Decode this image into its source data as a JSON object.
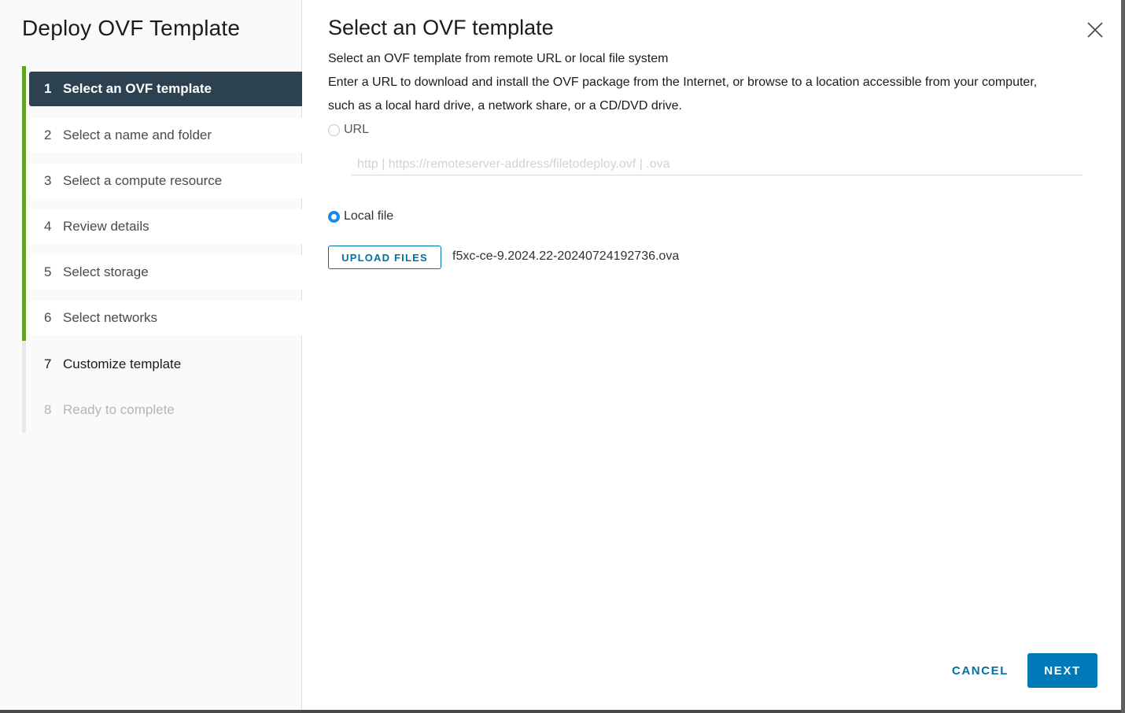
{
  "wizard": {
    "title": "Deploy OVF Template",
    "steps": [
      {
        "number": "1",
        "label": "Select an OVF template",
        "state": "active"
      },
      {
        "number": "2",
        "label": "Select a name and folder",
        "state": "done"
      },
      {
        "number": "3",
        "label": "Select a compute resource",
        "state": "done"
      },
      {
        "number": "4",
        "label": "Review details",
        "state": "done"
      },
      {
        "number": "5",
        "label": "Select storage",
        "state": "done"
      },
      {
        "number": "6",
        "label": "Select networks",
        "state": "done"
      },
      {
        "number": "7",
        "label": "Customize template",
        "state": "next"
      },
      {
        "number": "8",
        "label": "Ready to complete",
        "state": "disabled"
      }
    ]
  },
  "page": {
    "title": "Select an OVF template",
    "subtitle": "Select an OVF template from remote URL or local file system",
    "description": "Enter a URL to download and install the OVF package from the Internet, or browse to a location accessible from your computer, such as a local hard drive, a network share, or a CD/DVD drive.",
    "source_options": {
      "url_label": "URL",
      "url_selected": false,
      "url_value": "",
      "url_placeholder": "http | https://remoteserver-address/filetodeploy.ovf | .ova",
      "local_label": "Local file",
      "local_selected": true
    },
    "upload_button_label": "UPLOAD FILES",
    "selected_file": "f5xc-ce-9.2024.22-20240724192736.ova"
  },
  "footer": {
    "cancel_label": "CANCEL",
    "next_label": "NEXT"
  },
  "colors": {
    "active_step_bg": "#2c4250",
    "progress_rail": "#62a420",
    "primary": "#0079b8",
    "link": "#0072a3",
    "radio_selected": "#1d88e5"
  }
}
